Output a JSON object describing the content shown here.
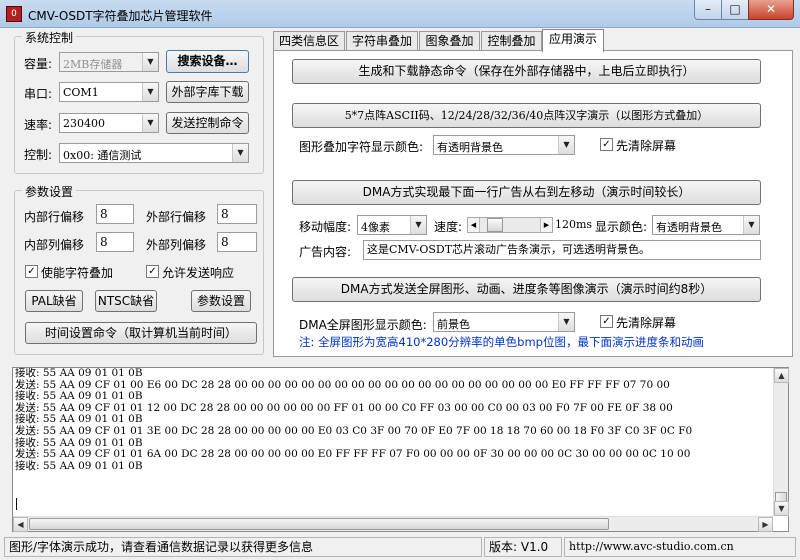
{
  "window": {
    "title": "CMV-OSDT字符叠加芯片管理软件",
    "app_icon_glyph": "O",
    "minimize_glyph": "–",
    "maximize_glyph": "□",
    "close_glyph": "✕"
  },
  "system_control": {
    "title": "系统控制",
    "capacity_label": "容量:",
    "capacity_value": "2MB存储器",
    "search_button": "搜索设备…",
    "port_label": "串口:",
    "port_value": "COM1",
    "font_download_button": "外部字库下载",
    "baud_label": "速率:",
    "baud_value": "230400",
    "send_control_button": "发送控制命令",
    "control_label": "控制:",
    "control_value": "0x00: 通信测试"
  },
  "params": {
    "title": "参数设置",
    "inner_row_label": "内部行偏移",
    "inner_row_value": "8",
    "outer_row_label": "外部行偏移",
    "outer_row_value": "8",
    "inner_col_label": "内部列偏移",
    "inner_col_value": "8",
    "outer_col_label": "外部列偏移",
    "outer_col_value": "8",
    "enable_overlay_label": "使能字符叠加",
    "enable_overlay_checked": true,
    "allow_response_label": "允许发送响应",
    "allow_response_checked": true,
    "pal_button": "PAL缺省",
    "ntsc_button": "NTSC缺省",
    "param_set_button": "参数设置",
    "time_set_button": "时间设置命令（取计算机当前时间）"
  },
  "tabs": [
    {
      "label": "四类信息区",
      "active": false
    },
    {
      "label": "字符串叠加",
      "active": false
    },
    {
      "label": "图象叠加",
      "active": false
    },
    {
      "label": "控制叠加",
      "active": false
    },
    {
      "label": "应用演示",
      "active": true
    }
  ],
  "demo": {
    "gen_static_button": "生成和下载静态命令（保存在外部存储器中，上电后立即执行）",
    "dot_matrix_button": "5*7点阵ASCII码、12/24/28/32/36/40点阵汉字演示（以图形方式叠加）",
    "graphic_color_label": "图形叠加字符显示颜色:",
    "graphic_color_value": "有透明背景色",
    "clear_screen_label_1": "先清除屏幕",
    "clear_screen_checked_1": true,
    "dma_scroll_button": "DMA方式实现最下面一行广告从右到左移动（演示时间较长）",
    "move_amp_label": "移动幅度:",
    "move_amp_value": "4像素",
    "speed_label": "速度:",
    "speed_fraction": 0.15,
    "speed_value": "120ms",
    "display_color_label": "显示颜色:",
    "display_color_value": "有透明背景色",
    "ad_content_label": "广告内容:",
    "ad_content_value": "这是CMV-OSDT芯片滚动广告条演示，可选透明背景色。",
    "dma_full_button": "DMA方式发送全屏图形、动画、进度条等图像演示（演示时间约8秒）",
    "dma_color_label": "DMA全屏图形显示颜色:",
    "dma_color_value": "前景色",
    "clear_screen_label_2": "先清除屏幕",
    "clear_screen_checked_2": true,
    "note": "注: 全屏图形为宽高410*280分辨率的单色bmp位图，最下面演示进度条和动画"
  },
  "log": {
    "lines": [
      "接收: 55 AA 09 01 01 0B",
      "发送: 55 AA 09 CF 01 00 E6 00 DC 28 28 00 00 00 00 00 00 00 00 00 00 00 00 00 00 00 00 00 00 00 E0 FF FF FF 07 70 00",
      "接收: 55 AA 09 01 01 0B",
      "发送: 55 AA 09 CF 01 01 12 00 DC 28 28 00 00 00 00 00 00 FF 01 00 00 C0 FF 03 00 00 C0 00 03 00 F0 7F 00 FE 0F 38 00",
      "接收: 55 AA 09 01 01 0B",
      "发送: 55 AA 09 CF 01 01 3E 00 DC 28 28 00 00 00 00 00 E0 03 C0 3F 00 70 0F E0 7F 00 18 18 70 60 00 18 F0 3F C0 3F 0C F0",
      "接收: 55 AA 09 01 01 0B",
      "发送: 55 AA 09 CF 01 01 6A 00 DC 28 28 00 00 00 00 00 E0 FF FF FF 07 F0 00 00 00 0F 30 00 00 00 0C 30 00 00 00 0C 10 00",
      "接收: 55 AA 09 01 01 0B"
    ]
  },
  "status": {
    "message": "图形/字体演示成功，请查看通信数据记录以获得更多信息",
    "version": "版本: V1.0",
    "url": "http://www.avc-studio.com.cn"
  }
}
